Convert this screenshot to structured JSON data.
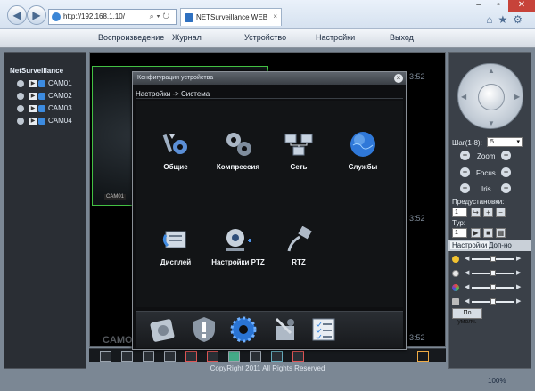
{
  "browser": {
    "address": "http://192.168.1.10/",
    "tab_title": "NETSurveillance WEB",
    "zoom": "100%"
  },
  "menu": {
    "items": [
      "Воспроизведение",
      "Журнал",
      "Устройство",
      "Настройки",
      "Выход"
    ]
  },
  "tree": {
    "root": "NetSurveillance",
    "cameras": [
      "CAM01",
      "CAM02",
      "CAM03",
      "CAM04"
    ]
  },
  "video": {
    "tile_tag": "CAM01",
    "ts1": "3:52",
    "ts2": "3:52",
    "ts3": "3:52",
    "bottom_label": "CAMO"
  },
  "ptz": {
    "step_label": "Шаг(1-8):",
    "step_value": "5",
    "zoom": "Zoom",
    "focus": "Focus",
    "iris": "Iris",
    "presets_label": "Предустановки:",
    "preset_value": "1",
    "tour_label": "Тур:",
    "tour_value": "1",
    "tab_settings": "Настройки",
    "tab_more": "Доп-но",
    "default_btn": "По умолч."
  },
  "modal": {
    "title": "Конфигурации устройства",
    "breadcrumb": "Настройки -> Система",
    "tiles": [
      "Общие",
      "Компрессия",
      "Сеть",
      "Службы",
      "Дисплей",
      "Настройки PTZ",
      "RTZ"
    ]
  },
  "footer": {
    "copyright": "CopyRight 2011 All Rights Reserved"
  },
  "colors": {
    "accent": "#3c8be0",
    "selected_tile_border": "#43c043"
  }
}
